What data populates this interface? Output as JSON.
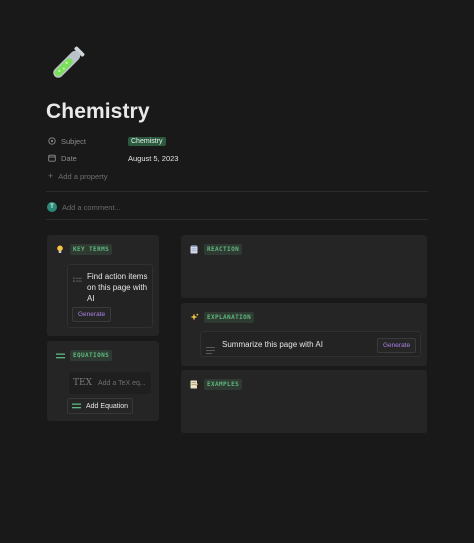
{
  "page": {
    "title": "Chemistry"
  },
  "properties": [
    {
      "key": "Subject",
      "icon": "circle-dot-icon",
      "value": "Chemistry",
      "is_tag": true,
      "tag_color": "#2b5a3f"
    },
    {
      "key": "Date",
      "icon": "calendar-icon",
      "value": "August 5, 2023",
      "is_tag": false
    }
  ],
  "add_property_label": "Add a property",
  "comment": {
    "avatar_letter": "T",
    "placeholder": "Add a comment..."
  },
  "cards": {
    "key_terms": {
      "icon": "lightbulb-icon",
      "label": "KEY TERMS",
      "ai_prompt": "Find action items on this page with AI",
      "button": "Generate"
    },
    "equations": {
      "icon": "equals-icon",
      "label": "EQUATIONS",
      "tex_glyph": "TEX",
      "input_placeholder": "Add a TeX eq...",
      "button": "Add Equation"
    },
    "reaction": {
      "icon": "notepad-icon",
      "label": "REACTION"
    },
    "explanation": {
      "icon": "sparkles-icon",
      "label": "EXPLANATION",
      "ai_prompt": "Summarize this page with AI",
      "button": "Generate"
    },
    "examples": {
      "icon": "memo-icon",
      "label": "EXAMPLES"
    }
  },
  "colors": {
    "background": "#191919",
    "card": "#252525",
    "code_tag_text": "#5fb87e",
    "generate_text": "#a881e6",
    "tag_bg": "#2b5a3f"
  }
}
